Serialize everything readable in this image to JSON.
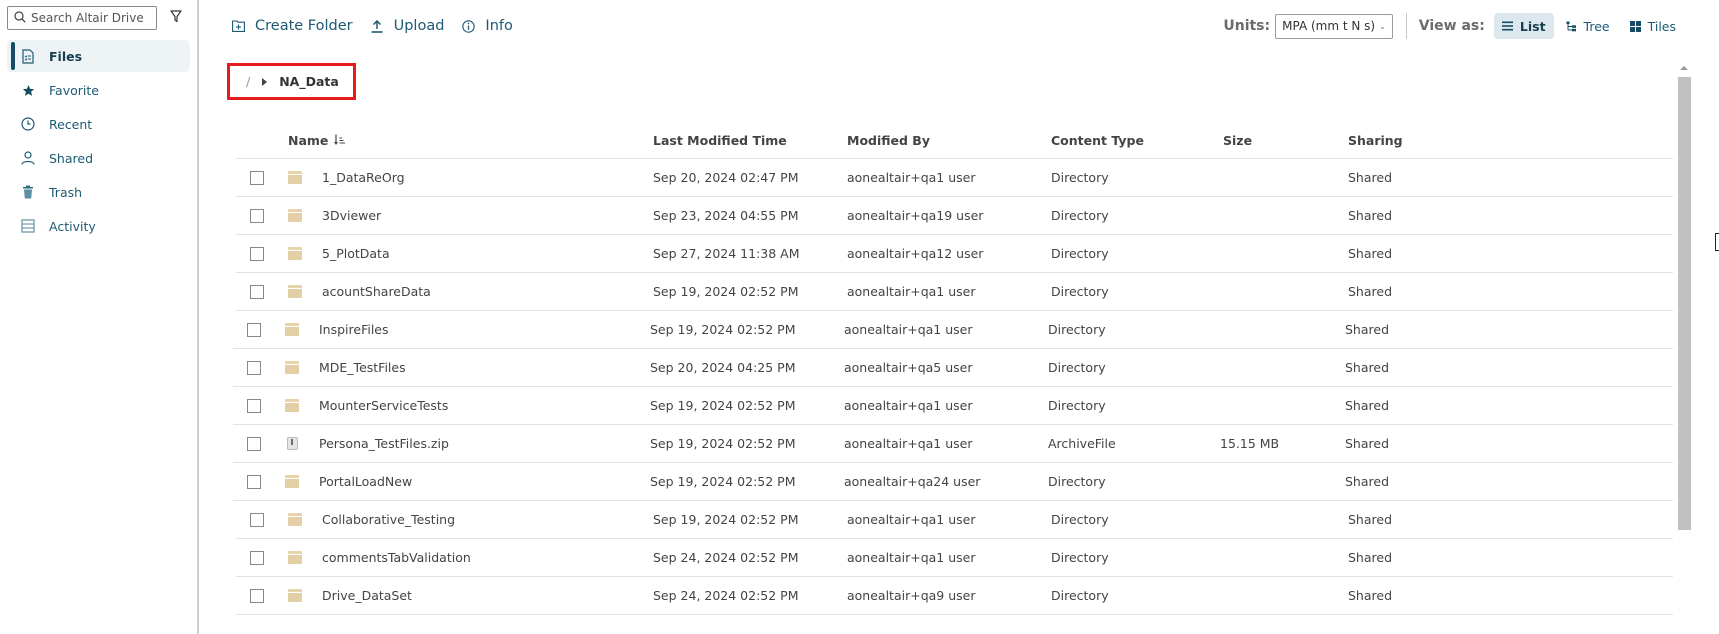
{
  "sidebar": {
    "search_placeholder": "Search Altair Drive",
    "items": [
      {
        "label": "Files",
        "icon": "file-list-icon",
        "active": true
      },
      {
        "label": "Favorite",
        "icon": "star-icon",
        "active": false
      },
      {
        "label": "Recent",
        "icon": "clock-icon",
        "active": false
      },
      {
        "label": "Shared",
        "icon": "user-icon",
        "active": false
      },
      {
        "label": "Trash",
        "icon": "trash-icon",
        "active": false
      },
      {
        "label": "Activity",
        "icon": "activity-list-icon",
        "active": false
      }
    ]
  },
  "toolbar": {
    "create_folder": "Create Folder",
    "upload": "Upload",
    "info": "Info",
    "units_label": "Units:",
    "units_value": "MPA (mm t N s)",
    "view_as_label": "View as:",
    "views": [
      {
        "label": "List",
        "active": true
      },
      {
        "label": "Tree",
        "active": false
      },
      {
        "label": "Tiles",
        "active": false
      }
    ]
  },
  "breadcrumb": {
    "root": "/",
    "current": "NA_Data"
  },
  "table": {
    "columns": [
      "Name",
      "Last Modified Time",
      "Modified By",
      "Content Type",
      "Size",
      "Sharing"
    ],
    "rows": [
      {
        "name": "1_DataReOrg",
        "time": "Sep 20, 2024 02:47 PM",
        "by": "aonealtair+qa1 user",
        "type": "Directory",
        "size": "",
        "sharing": "Shared",
        "kind": "folder"
      },
      {
        "name": "3Dviewer",
        "time": "Sep 23, 2024 04:55 PM",
        "by": "aonealtair+qa19 user",
        "type": "Directory",
        "size": "",
        "sharing": "Shared",
        "kind": "folder"
      },
      {
        "name": "5_PlotData",
        "time": "Sep 27, 2024 11:38 AM",
        "by": "aonealtair+qa12 user",
        "type": "Directory",
        "size": "",
        "sharing": "Shared",
        "kind": "folder"
      },
      {
        "name": "acountShareData",
        "time": "Sep 19, 2024 02:52 PM",
        "by": "aonealtair+qa1 user",
        "type": "Directory",
        "size": "",
        "sharing": "Shared",
        "kind": "folder"
      },
      {
        "name": "InspireFiles",
        "time": "Sep 19, 2024 02:52 PM",
        "by": "aonealtair+qa1 user",
        "type": "Directory",
        "size": "",
        "sharing": "Shared",
        "kind": "folder"
      },
      {
        "name": "MDE_TestFiles",
        "time": "Sep 20, 2024 04:25 PM",
        "by": "aonealtair+qa5 user",
        "type": "Directory",
        "size": "",
        "sharing": "Shared",
        "kind": "folder"
      },
      {
        "name": "MounterServiceTests",
        "time": "Sep 19, 2024 02:52 PM",
        "by": "aonealtair+qa1 user",
        "type": "Directory",
        "size": "",
        "sharing": "Shared",
        "kind": "folder"
      },
      {
        "name": "Persona_TestFiles.zip",
        "time": "Sep 19, 2024 02:52 PM",
        "by": "aonealtair+qa1 user",
        "type": "ArchiveFile",
        "size": "15.15 MB",
        "sharing": "Shared",
        "kind": "zip"
      },
      {
        "name": "PortalLoadNew",
        "time": "Sep 19, 2024 02:52 PM",
        "by": "aonealtair+qa24 user",
        "type": "Directory",
        "size": "",
        "sharing": "Shared",
        "kind": "folder"
      },
      {
        "name": "Collaborative_Testing",
        "time": "Sep 19, 2024 02:52 PM",
        "by": "aonealtair+qa1 user",
        "type": "Directory",
        "size": "",
        "sharing": "Shared",
        "kind": "folder"
      },
      {
        "name": "commentsTabValidation",
        "time": "Sep 24, 2024 02:52 PM",
        "by": "aonealtair+qa1 user",
        "type": "Directory",
        "size": "",
        "sharing": "Shared",
        "kind": "folder"
      },
      {
        "name": "Drive_DataSet",
        "time": "Sep 24, 2024 02:52 PM",
        "by": "aonealtair+qa9 user",
        "type": "Directory",
        "size": "",
        "sharing": "Shared",
        "kind": "folder"
      }
    ]
  },
  "colors": {
    "accent": "#1d5a73",
    "active_bg": "#eef3f6",
    "highlight_border": "#e51c1c",
    "folder": "#e2cfa6"
  }
}
